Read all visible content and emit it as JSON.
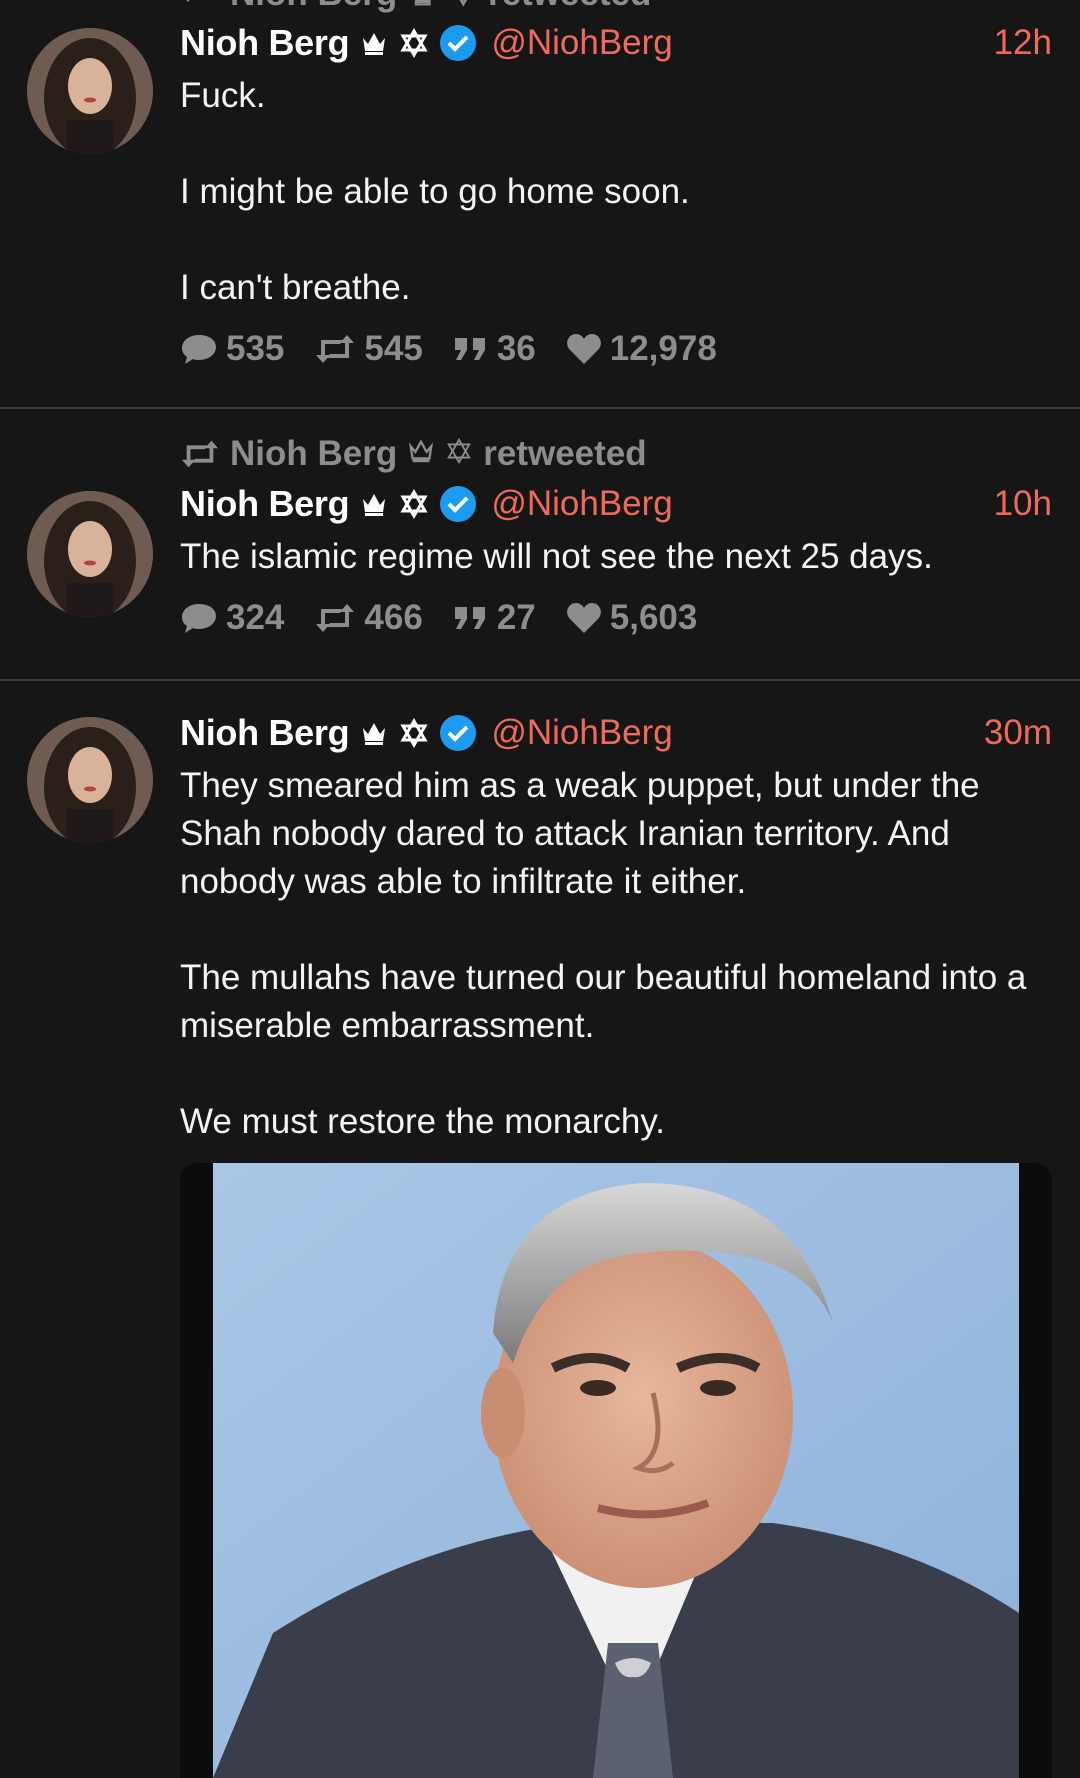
{
  "colors": {
    "accent": "#f06a5b",
    "muted": "#8d8d8f",
    "verified": "#1d9bf0",
    "background": "#161617"
  },
  "cut_off_header": {
    "retweeter": "Nioh Berg",
    "label": "retweeted"
  },
  "tweets": [
    {
      "name": "Nioh Berg",
      "handle": "@NiohBerg",
      "time": "12h",
      "paragraphs": [
        "Fuck.",
        "I might be able to go home soon.",
        "I can't breathe."
      ],
      "stats": {
        "replies": "535",
        "retweets": "545",
        "quotes": "36",
        "likes": "12,978"
      }
    },
    {
      "retweeted_by": {
        "name": "Nioh Berg",
        "label": "retweeted"
      },
      "name": "Nioh Berg",
      "handle": "@NiohBerg",
      "time": "10h",
      "paragraphs": [
        "The islamic regime will not see the next 25 days."
      ],
      "stats": {
        "replies": "324",
        "retweets": "466",
        "quotes": "27",
        "likes": "5,603"
      }
    },
    {
      "name": "Nioh Berg",
      "handle": "@NiohBerg",
      "time": "30m",
      "paragraphs": [
        "They smeared him as a weak puppet, but under the Shah nobody dared to attack Iranian territory. And nobody was able to infiltrate it either.",
        "The mullahs have turned our beautiful homeland into a miserable embarrassment.",
        "We must restore the monarchy."
      ]
    }
  ]
}
